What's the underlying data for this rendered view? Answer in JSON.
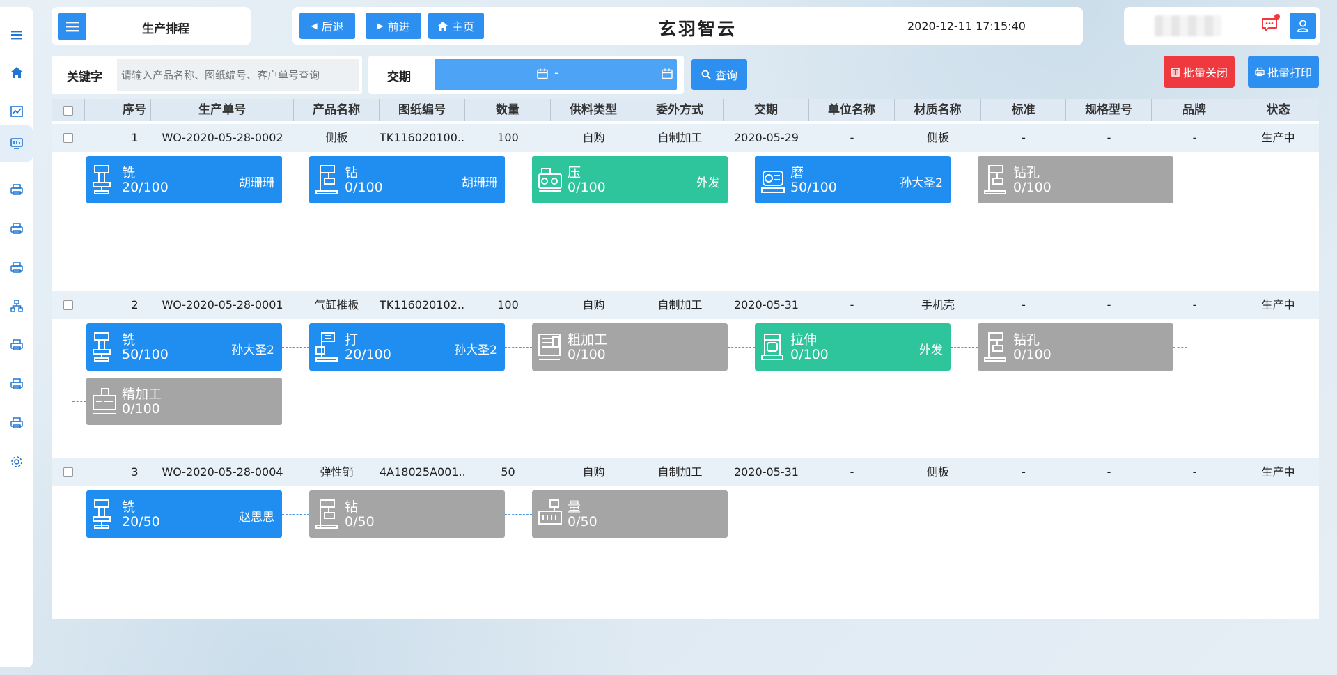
{
  "sidebar": {
    "items": [
      {
        "icon": "menu-icon"
      },
      {
        "icon": "home-icon"
      },
      {
        "icon": "chart-icon"
      },
      {
        "icon": "monitor-icon",
        "active": true
      },
      {
        "icon": "printer-icon"
      },
      {
        "icon": "printer-icon"
      },
      {
        "icon": "printer-icon"
      },
      {
        "icon": "org-chart-icon"
      },
      {
        "icon": "printer-icon"
      },
      {
        "icon": "printer-icon"
      },
      {
        "icon": "printer-icon"
      },
      {
        "icon": "gear-icon"
      }
    ]
  },
  "header": {
    "page_title": "生产排程",
    "back_label": "后退",
    "forward_label": "前进",
    "home_label": "主页",
    "app_title": "玄羽智云",
    "datetime": "2020-12-11 17:15:40"
  },
  "filters": {
    "keyword_label": "关键字",
    "keyword_placeholder": "请输入产品名称、图纸编号、客户单号查询",
    "delivery_label": "交期",
    "delivery_value": "-",
    "query_label": "查询",
    "batch_close_label": "批量关闭",
    "batch_print_label": "批量打印"
  },
  "table": {
    "headers": [
      "序号",
      "生产单号",
      "产品名称",
      "图纸编号",
      "数量",
      "供料类型",
      "委外方式",
      "交期",
      "单位名称",
      "材质名称",
      "标准",
      "规格型号",
      "品牌",
      "状态"
    ],
    "rows": [
      {
        "cells": [
          "1",
          "WO-2020-05-28-0002",
          "侧板",
          "TK116020100...",
          "100",
          "自购",
          "自制加工",
          "2020-05-29",
          "-",
          "侧板",
          "-",
          "-",
          "-",
          "生产中"
        ],
        "processes": [
          {
            "name": "铣",
            "count": "20/100",
            "worker": "胡珊珊",
            "color": "blue",
            "icon": "milling-machine-icon"
          },
          {
            "name": "钻",
            "count": "0/100",
            "worker": "胡珊珊",
            "color": "blue",
            "icon": "drill-press-icon"
          },
          {
            "name": "压",
            "count": "0/100",
            "worker": "外发",
            "color": "green",
            "icon": "press-machine-icon"
          },
          {
            "name": "磨",
            "count": "50/100",
            "worker": "孙大圣2",
            "color": "blue",
            "icon": "grinder-icon"
          },
          {
            "name": "钻孔",
            "count": "0/100",
            "worker": "",
            "color": "gray",
            "icon": "drill-press-icon"
          }
        ]
      },
      {
        "cells": [
          "2",
          "WO-2020-05-28-0001",
          "气缸推板",
          "TK116020102...",
          "100",
          "自购",
          "自制加工",
          "2020-05-31",
          "-",
          "手机壳",
          "-",
          "-",
          "-",
          "生产中"
        ],
        "processes": [
          {
            "name": "铣",
            "count": "50/100",
            "worker": "孙大圣2",
            "color": "blue",
            "icon": "milling-machine-icon"
          },
          {
            "name": "打",
            "count": "20/100",
            "worker": "孙大圣2",
            "color": "blue",
            "icon": "punch-machine-icon"
          },
          {
            "name": "粗加工",
            "count": "0/100",
            "worker": "",
            "color": "gray",
            "icon": "lathe-icon"
          },
          {
            "name": "拉伸",
            "count": "0/100",
            "worker": "外发",
            "color": "green",
            "icon": "stretch-machine-icon"
          },
          {
            "name": "钻孔",
            "count": "0/100",
            "worker": "",
            "color": "gray",
            "icon": "drill-press-icon"
          },
          {
            "name": "精加工",
            "count": "0/100",
            "worker": "",
            "color": "gray",
            "icon": "cnc-machine-icon"
          }
        ]
      },
      {
        "cells": [
          "3",
          "WO-2020-05-28-0004",
          "弹性销",
          "4A18025A001...",
          "50",
          "自购",
          "自制加工",
          "2020-05-31",
          "-",
          "侧板",
          "-",
          "-",
          "-",
          "生产中"
        ],
        "processes": [
          {
            "name": "铣",
            "count": "20/50",
            "worker": "赵思思",
            "color": "blue",
            "icon": "milling-machine-icon"
          },
          {
            "name": "钻",
            "count": "0/50",
            "worker": "",
            "color": "gray",
            "icon": "drill-press-icon"
          },
          {
            "name": "量",
            "count": "0/50",
            "worker": "",
            "color": "gray",
            "icon": "measuring-machine-icon"
          }
        ]
      }
    ]
  }
}
